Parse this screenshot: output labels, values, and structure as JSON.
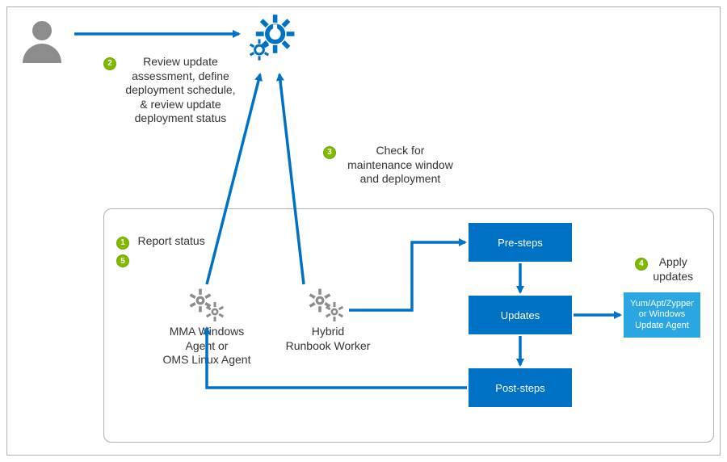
{
  "steps": {
    "s1": {
      "num": "1",
      "text": "Report status"
    },
    "s2": {
      "num": "2",
      "text": "Review update\nassessment, define\ndeployment schedule,\n& review update\ndeployment status"
    },
    "s3": {
      "num": "3",
      "text": "Check for\nmaintenance window\nand deployment"
    },
    "s4": {
      "num": "4",
      "text": "Apply\nupdates"
    },
    "s5": {
      "num": "5"
    }
  },
  "nodes": {
    "mma": "MMA Windows\nAgent or\nOMS Linux Agent",
    "hybrid": "Hybrid\nRunbook Worker",
    "pre": "Pre-steps",
    "updates": "Updates",
    "post": "Post-steps",
    "yum": "Yum/Apt/Zypper\nor Windows\nUpdate Agent"
  }
}
